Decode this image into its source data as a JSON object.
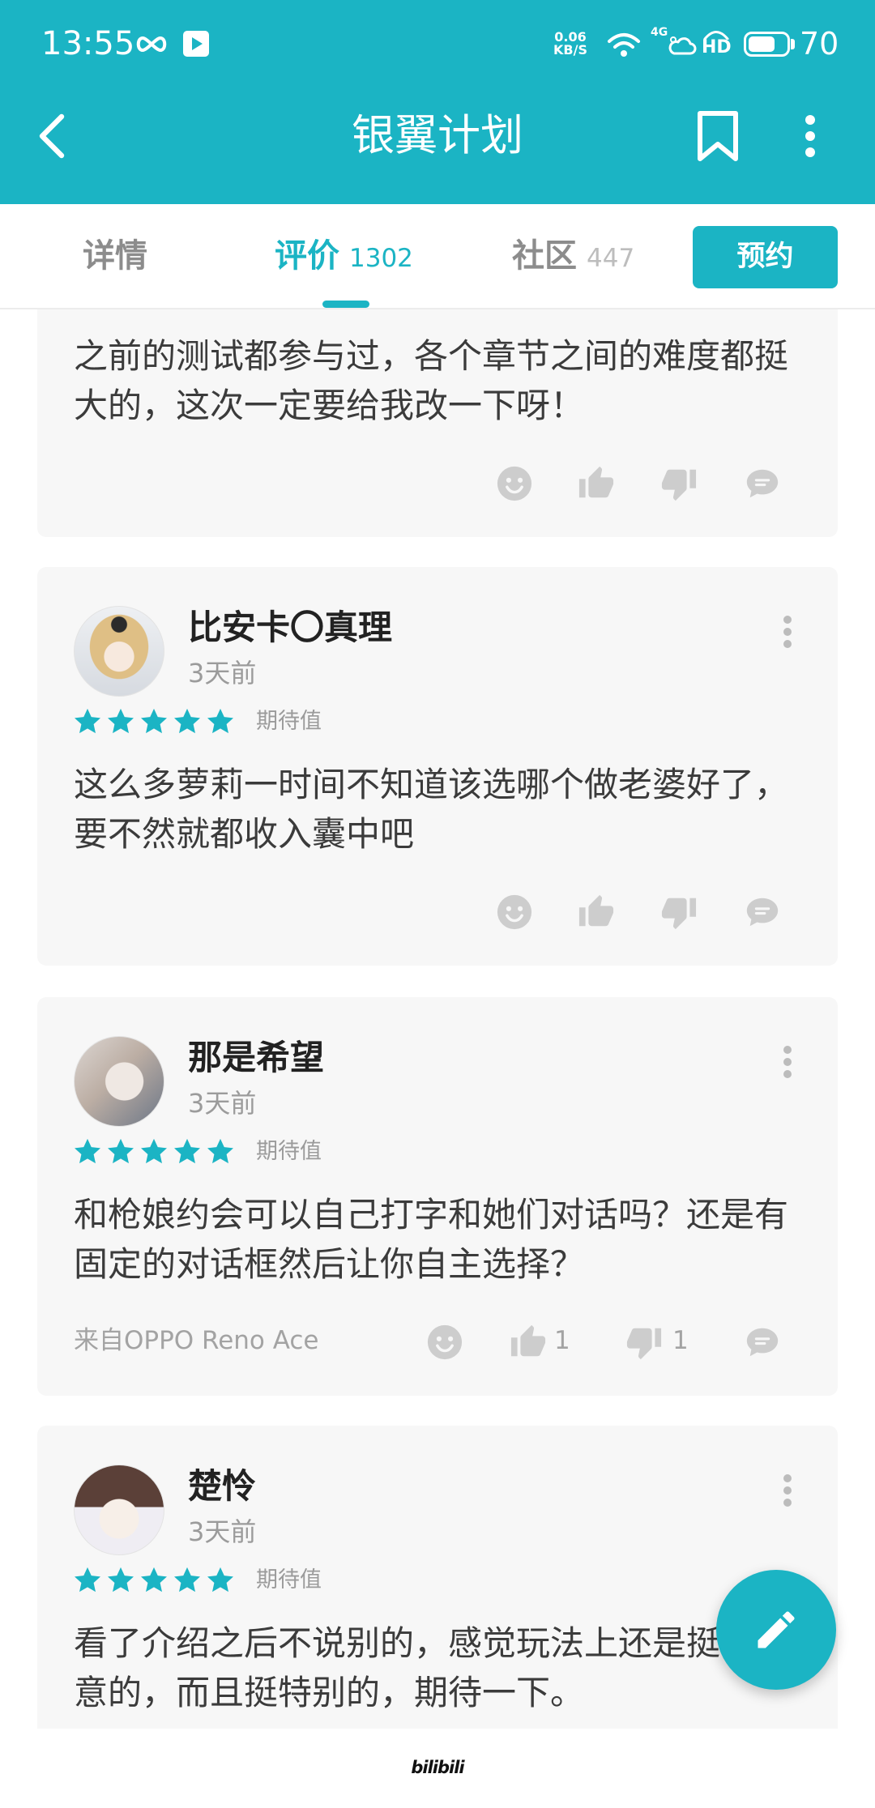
{
  "colors": {
    "accent": "#1bb4c4",
    "card_background": "#f7f7f7",
    "icon_gray": "#cdcdcd"
  },
  "status_bar": {
    "time": "13:55",
    "net_speed_value": "0.06",
    "net_speed_unit": "KB/S",
    "network_type": "4G",
    "hd_label": "HD",
    "battery_level": "70",
    "icons": [
      "infinity-icon",
      "video-play-icon",
      "wifi-icon",
      "weather-cloud-icon",
      "battery-icon"
    ]
  },
  "header": {
    "title": "银翼计划",
    "icons": [
      "back-icon",
      "bookmark-icon",
      "more-vertical-icon"
    ]
  },
  "tabs": [
    {
      "label": "详情"
    },
    {
      "label": "评价",
      "count": "1302",
      "active": true
    },
    {
      "label": "社区",
      "count": "447"
    }
  ],
  "reserve_button": {
    "label": "预约"
  },
  "reviews": [
    {
      "lines": [
        "之前的测试都参与过，各个章节之间的难度都挺",
        "大的，这次一定要给我改一下呀！"
      ]
    },
    {
      "author": "比安卡〇真理",
      "time": "3天前",
      "rating": 5,
      "rating_label": "期待值",
      "lines": [
        "这么多萝莉一时间不知道该选哪个做老婆好了，",
        "要不然就都收入囊中吧"
      ]
    },
    {
      "author": "那是希望",
      "time": "3天前",
      "rating": 5,
      "rating_label": "期待值",
      "lines": [
        "和枪娘约会可以自己打字和她们对话吗？还是有",
        "固定的对话框然后让你自主选择？"
      ],
      "device": "来自OPPO Reno Ace",
      "likes": "1",
      "dislikes": "1"
    },
    {
      "author": "楚怜",
      "time": "3天前",
      "rating": 5,
      "rating_label": "期待值",
      "lines": [
        "看了介绍之后不说别的，感觉玩法上还是挺",
        "意的，而且挺特别的，期待一下。"
      ]
    }
  ],
  "review_actions": [
    "emoji-reaction-icon",
    "thumbs-up-icon",
    "thumbs-down-icon",
    "comment-icon"
  ],
  "fab": {
    "icon": "edit-pencil-icon"
  },
  "watermark": {
    "text": "bilibili"
  }
}
